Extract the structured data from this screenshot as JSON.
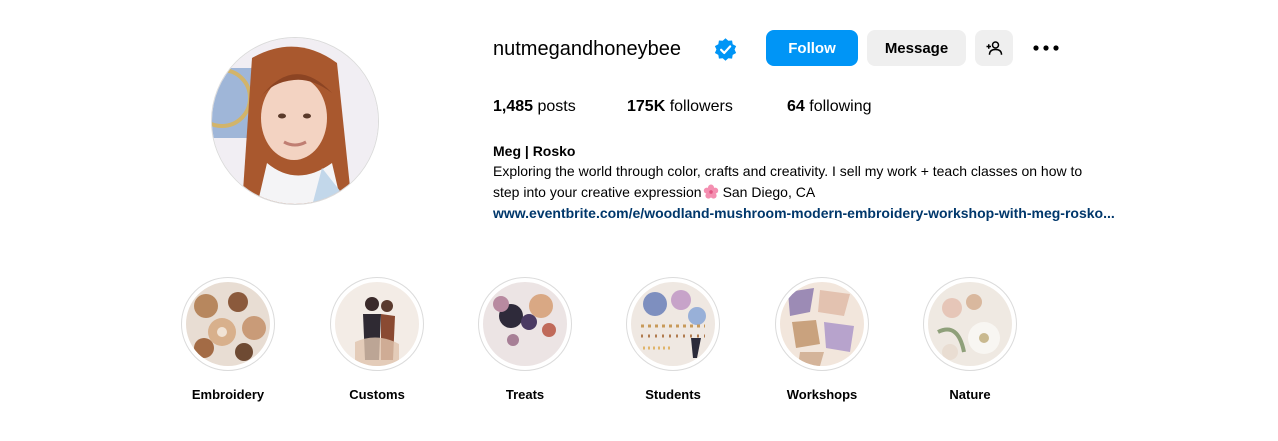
{
  "profile": {
    "username": "nutmegandhoneybee",
    "verified": true,
    "full_name": "Meg | Rosko",
    "bio_line1": "Exploring the world through color, crafts and creativity. I sell my work + teach classes on how to",
    "bio_line2_pre": "step into your creative expression",
    "bio_emoji": "cherry-blossom-icon",
    "bio_line2_post": "San Diego, CA",
    "link": "www.eventbrite.com/e/woodland-mushroom-modern-embroidery-workshop-with-meg-rosko..."
  },
  "actions": {
    "follow_label": "Follow",
    "message_label": "Message",
    "suggest_icon": "person-plus-icon",
    "more_icon": "ellipsis-icon"
  },
  "stats": {
    "posts_count": "1,485",
    "posts_label": "posts",
    "followers_count": "175K",
    "followers_label": "followers",
    "following_count": "64",
    "following_label": "following"
  },
  "highlights": [
    {
      "label": "Embroidery"
    },
    {
      "label": "Customs"
    },
    {
      "label": "Treats"
    },
    {
      "label": "Students"
    },
    {
      "label": "Workshops"
    },
    {
      "label": "Nature"
    }
  ],
  "colors": {
    "accent": "#0095f6",
    "secondary_button": "#efefef",
    "link": "#00376b",
    "verified": "#0095f6"
  }
}
